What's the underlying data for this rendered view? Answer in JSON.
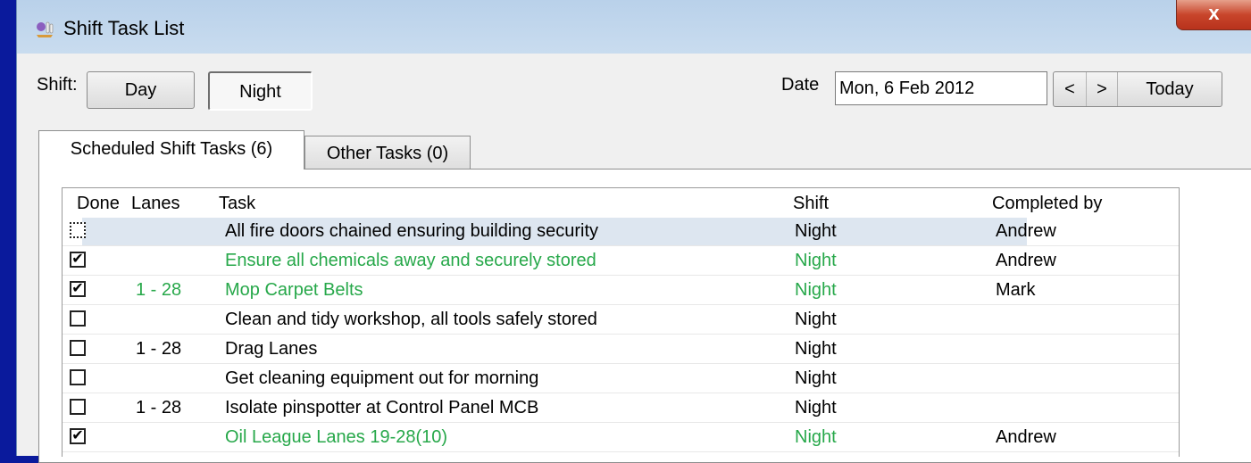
{
  "window": {
    "title": "Shift Task List",
    "close_symbol": "x"
  },
  "shift": {
    "label": "Shift:",
    "day_label": "Day",
    "night_label": "Night"
  },
  "date": {
    "label": "Date",
    "value": "Mon, 6 Feb 2012",
    "prev_label": "<",
    "next_label": ">",
    "today_label": "Today"
  },
  "tabs": [
    {
      "label": "Scheduled Shift Tasks (6)"
    },
    {
      "label": "Other Tasks (0)"
    }
  ],
  "grid": {
    "headers": {
      "done": "Done",
      "lanes": "Lanes",
      "task": "Task",
      "shift": "Shift",
      "completed_by": "Completed by"
    },
    "rows": [
      {
        "done": false,
        "lanes": "",
        "task": "All fire doors chained ensuring building security",
        "shift": "Night",
        "completed_by": "Andrew"
      },
      {
        "done": true,
        "lanes": "",
        "task": "Ensure all chemicals away and securely stored",
        "shift": "Night",
        "completed_by": "Andrew"
      },
      {
        "done": true,
        "lanes": "1 - 28",
        "task": "Mop Carpet Belts",
        "shift": "Night",
        "completed_by": "Mark"
      },
      {
        "done": false,
        "lanes": "",
        "task": "Clean and tidy workshop, all tools safely stored",
        "shift": "Night",
        "completed_by": ""
      },
      {
        "done": false,
        "lanes": "1 - 28",
        "task": "Drag Lanes",
        "shift": "Night",
        "completed_by": ""
      },
      {
        "done": false,
        "lanes": "",
        "task": "Get cleaning equipment out for morning",
        "shift": "Night",
        "completed_by": ""
      },
      {
        "done": false,
        "lanes": "1 - 28",
        "task": "Isolate pinspotter at Control Panel MCB",
        "shift": "Night",
        "completed_by": ""
      },
      {
        "done": true,
        "lanes": "",
        "task": "Oil League Lanes 19-28(10)",
        "shift": "Night",
        "completed_by": "Andrew"
      }
    ]
  },
  "colors": {
    "done_text": "#27a84a",
    "selected_row": "#dde6f0",
    "desktop": "#0a1a9c"
  },
  "icons": {
    "app": "bowling-icon",
    "close": "close-icon",
    "check": "✔"
  }
}
